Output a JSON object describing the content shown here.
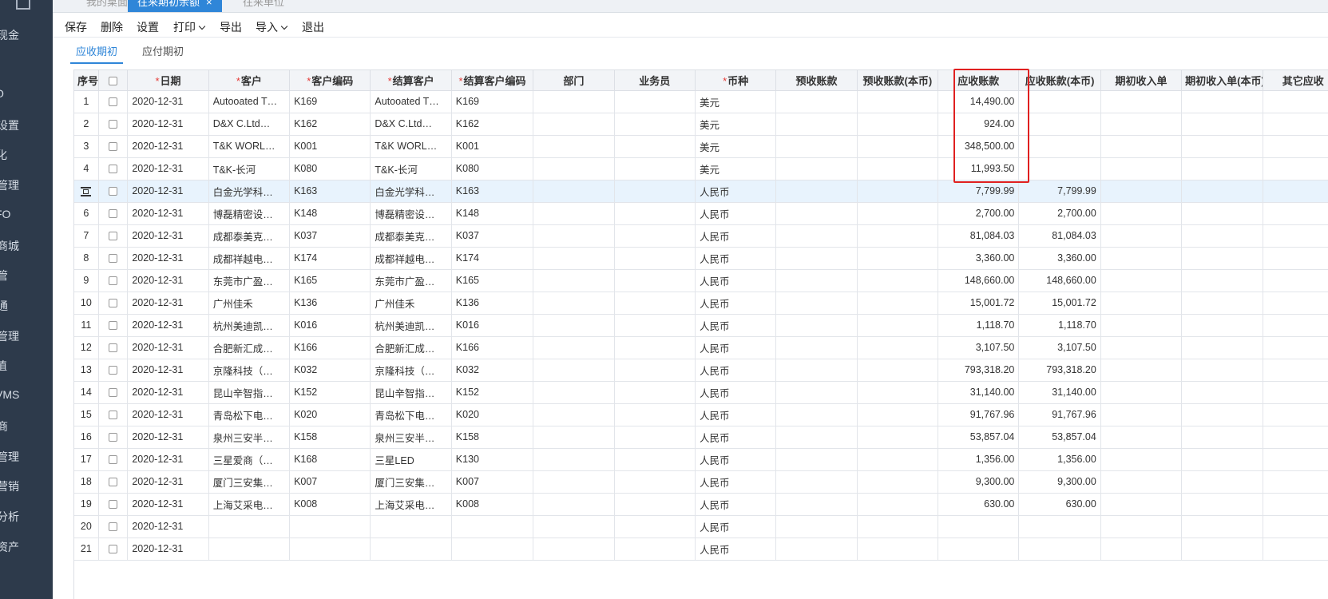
{
  "sidebar": {
    "items": [
      "现金",
      "O",
      "设置",
      "化",
      "管理",
      "FO",
      "商城",
      "管",
      "通",
      "管理",
      "值",
      "VMS",
      "商",
      "管理",
      "营销",
      "分析",
      "资产"
    ]
  },
  "tabs": [
    {
      "label": "我的桌面"
    },
    {
      "label": "往来期初余额",
      "close": "×"
    },
    {
      "label": "往来单位"
    }
  ],
  "toolbar": {
    "save": "保存",
    "delete": "删除",
    "settings": "设置",
    "print": "打印",
    "export": "导出",
    "import": "导入",
    "exit": "退出"
  },
  "subtabs": {
    "receivable": "应收期初",
    "payable": "应付期初"
  },
  "table": {
    "headers": {
      "seq": "序号",
      "date": "日期",
      "customer": "客户",
      "customer_code": "客户编码",
      "settle_customer": "结算客户",
      "settle_code": "结算客户编码",
      "dept": "部门",
      "salesman": "业务员",
      "currency": "币种",
      "prepaid": "预收账款",
      "prepaid_local": "预收账款(本币)",
      "receivable": "应收账款",
      "receivable_local": "应收账款(本币)",
      "init_income": "期初收入单",
      "init_income_local": "期初收入单(本币)",
      "other": "其它应收"
    },
    "rows": [
      {
        "seq": "1",
        "date": "2020-12-31",
        "customer": "Autooated T…",
        "code": "K169",
        "settle": "Autooated T…",
        "settle_code": "K169",
        "currency": "美元",
        "receivable": "14,490.00",
        "receivable_local": ""
      },
      {
        "seq": "2",
        "date": "2020-12-31",
        "customer": "D&X C.Ltd…",
        "code": "K162",
        "settle": "D&X C.Ltd…",
        "settle_code": "K162",
        "currency": "美元",
        "receivable": "924.00",
        "receivable_local": ""
      },
      {
        "seq": "3",
        "date": "2020-12-31",
        "customer": "T&K WORL…",
        "code": "K001",
        "settle": "T&K WORL…",
        "settle_code": "K001",
        "currency": "美元",
        "receivable": "348,500.00",
        "receivable_local": ""
      },
      {
        "seq": "4",
        "date": "2020-12-31",
        "customer": "T&K-长河",
        "code": "K080",
        "settle": "T&K-长河",
        "settle_code": "K080",
        "currency": "美元",
        "receivable": "11,993.50",
        "receivable_local": ""
      },
      {
        "seq": "",
        "date": "2020-12-31",
        "customer": "白金光学科…",
        "code": "K163",
        "settle": "白金光学科…",
        "settle_code": "K163",
        "currency": "人民币",
        "receivable": "7,799.99",
        "receivable_local": "7,799.99"
      },
      {
        "seq": "6",
        "date": "2020-12-31",
        "customer": "博磊精密设…",
        "code": "K148",
        "settle": "博磊精密设…",
        "settle_code": "K148",
        "currency": "人民币",
        "receivable": "2,700.00",
        "receivable_local": "2,700.00"
      },
      {
        "seq": "7",
        "date": "2020-12-31",
        "customer": "成都泰美克…",
        "code": "K037",
        "settle": "成都泰美克…",
        "settle_code": "K037",
        "currency": "人民币",
        "receivable": "81,084.03",
        "receivable_local": "81,084.03"
      },
      {
        "seq": "8",
        "date": "2020-12-31",
        "customer": "成都祥越电…",
        "code": "K174",
        "settle": "成都祥越电…",
        "settle_code": "K174",
        "currency": "人民币",
        "receivable": "3,360.00",
        "receivable_local": "3,360.00"
      },
      {
        "seq": "9",
        "date": "2020-12-31",
        "customer": "东莞市广盈…",
        "code": "K165",
        "settle": "东莞市广盈…",
        "settle_code": "K165",
        "currency": "人民币",
        "receivable": "148,660.00",
        "receivable_local": "148,660.00"
      },
      {
        "seq": "10",
        "date": "2020-12-31",
        "customer": "广州佳禾",
        "code": "K136",
        "settle": "广州佳禾",
        "settle_code": "K136",
        "currency": "人民币",
        "receivable": "15,001.72",
        "receivable_local": "15,001.72"
      },
      {
        "seq": "11",
        "date": "2020-12-31",
        "customer": "杭州美迪凯…",
        "code": "K016",
        "settle": "杭州美迪凯…",
        "settle_code": "K016",
        "currency": "人民币",
        "receivable": "1,118.70",
        "receivable_local": "1,118.70"
      },
      {
        "seq": "12",
        "date": "2020-12-31",
        "customer": "合肥新汇成…",
        "code": "K166",
        "settle": "合肥新汇成…",
        "settle_code": "K166",
        "currency": "人民币",
        "receivable": "3,107.50",
        "receivable_local": "3,107.50"
      },
      {
        "seq": "13",
        "date": "2020-12-31",
        "customer": "京隆科技（…",
        "code": "K032",
        "settle": "京隆科技（…",
        "settle_code": "K032",
        "currency": "人民币",
        "receivable": "793,318.20",
        "receivable_local": "793,318.20"
      },
      {
        "seq": "14",
        "date": "2020-12-31",
        "customer": "昆山辛智指…",
        "code": "K152",
        "settle": "昆山辛智指…",
        "settle_code": "K152",
        "currency": "人民币",
        "receivable": "31,140.00",
        "receivable_local": "31,140.00"
      },
      {
        "seq": "15",
        "date": "2020-12-31",
        "customer": "青岛松下电…",
        "code": "K020",
        "settle": "青岛松下电…",
        "settle_code": "K020",
        "currency": "人民币",
        "receivable": "91,767.96",
        "receivable_local": "91,767.96"
      },
      {
        "seq": "16",
        "date": "2020-12-31",
        "customer": "泉州三安半…",
        "code": "K158",
        "settle": "泉州三安半…",
        "settle_code": "K158",
        "currency": "人民币",
        "receivable": "53,857.04",
        "receivable_local": "53,857.04"
      },
      {
        "seq": "17",
        "date": "2020-12-31",
        "customer": "三星爱商（…",
        "code": "K168",
        "settle": "三星LED",
        "settle_code": "K130",
        "currency": "人民币",
        "receivable": "1,356.00",
        "receivable_local": "1,356.00"
      },
      {
        "seq": "18",
        "date": "2020-12-31",
        "customer": "厦门三安集…",
        "code": "K007",
        "settle": "厦门三安集…",
        "settle_code": "K007",
        "currency": "人民币",
        "receivable": "9,300.00",
        "receivable_local": "9,300.00"
      },
      {
        "seq": "19",
        "date": "2020-12-31",
        "customer": "上海艾采电…",
        "code": "K008",
        "settle": "上海艾采电…",
        "settle_code": "K008",
        "currency": "人民币",
        "receivable": "630.00",
        "receivable_local": "630.00"
      },
      {
        "seq": "20",
        "date": "2020-12-31",
        "customer": "",
        "code": "",
        "settle": "",
        "settle_code": "",
        "currency": "人民币",
        "receivable": "",
        "receivable_local": ""
      },
      {
        "seq": "21",
        "date": "2020-12-31",
        "customer": "",
        "code": "",
        "settle": "",
        "settle_code": "",
        "currency": "人民币",
        "receivable": "",
        "receivable_local": ""
      }
    ]
  },
  "colors": {
    "accent": "#2f86d8",
    "sidebar_bg": "#2d3a4b",
    "highlight": "#e02020",
    "required": "#e53935",
    "selected_row": "#e8f3fd"
  },
  "icons": {
    "row_edit": "row-edit-icon",
    "checkbox": "checkbox-icon"
  },
  "state": {
    "selected_row_index": 4
  }
}
